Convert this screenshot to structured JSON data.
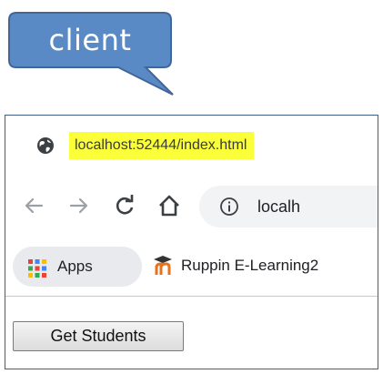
{
  "callout": {
    "text": "client"
  },
  "browser": {
    "tab": {
      "title": "localhost:52444/index.html",
      "favicon": "globe-icon"
    },
    "toolbar": {
      "icons": [
        "back-arrow-icon",
        "forward-arrow-icon",
        "reload-icon",
        "home-icon",
        "info-icon"
      ],
      "address_text": "localh"
    },
    "bookmarks": [
      {
        "label": "Apps",
        "icon": "apps-grid-icon"
      },
      {
        "label": "Ruppin E-Learning2",
        "icon": "ruppin-logo-icon"
      }
    ],
    "page": {
      "button_label": "Get Students"
    }
  },
  "colors": {
    "callout": "#5a8ac6",
    "highlight": "#fbff3a",
    "window_border": "#3e5f86"
  }
}
